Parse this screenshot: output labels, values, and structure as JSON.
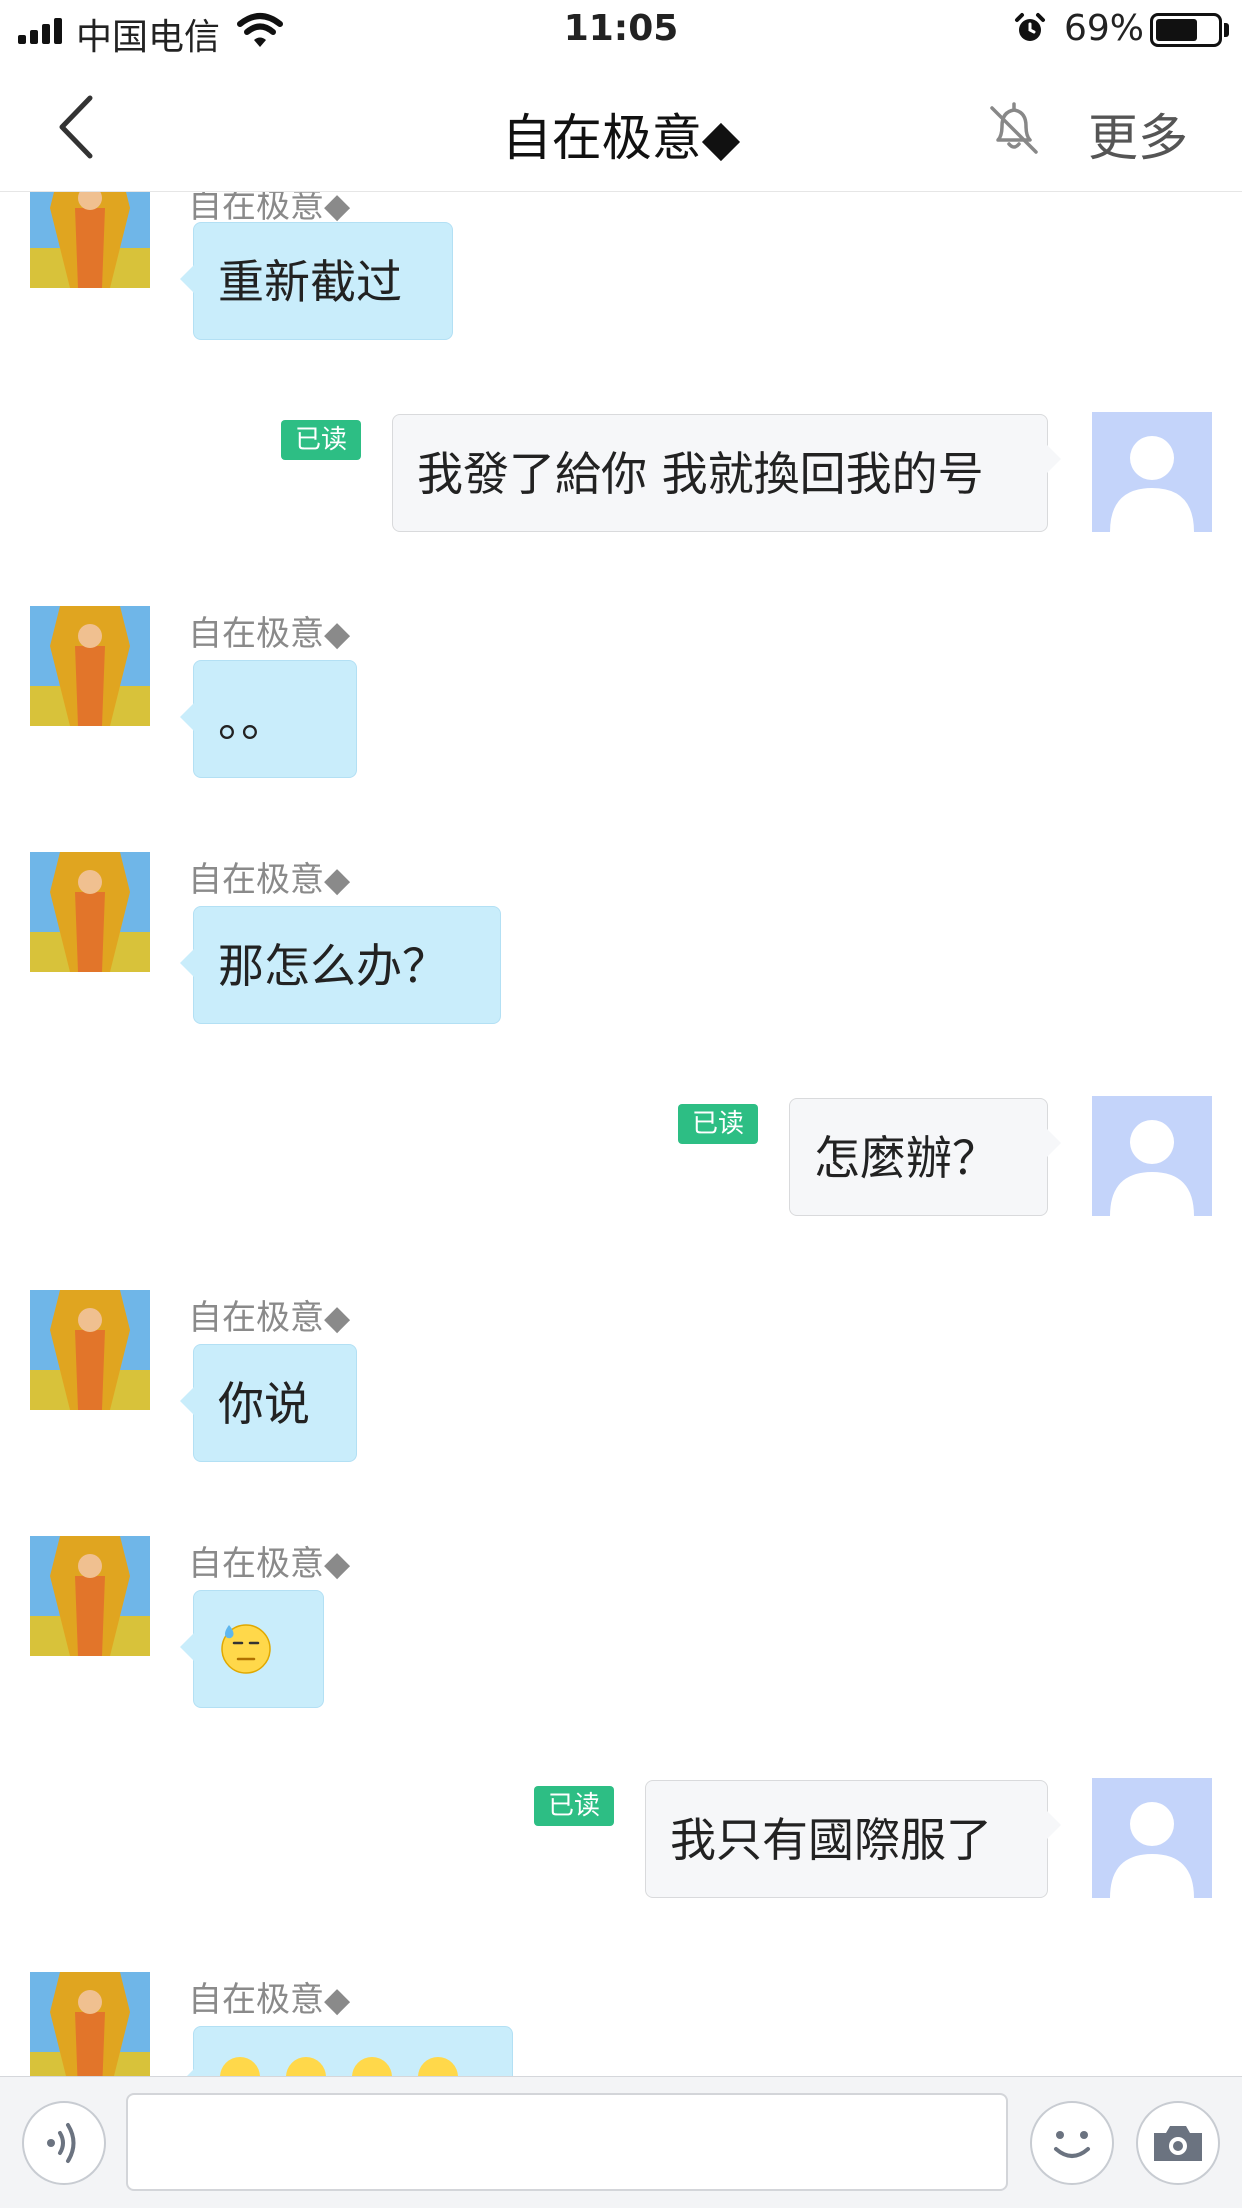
{
  "status_bar": {
    "carrier": "中国电信",
    "time": "11:05",
    "battery_percent": "69%",
    "battery_level": 0.69,
    "icons": [
      "signal-icon",
      "wifi-icon",
      "alarm-icon",
      "battery-icon"
    ]
  },
  "nav": {
    "title": "自在极意◆",
    "more_label": "更多",
    "icons": [
      "back-chevron-icon",
      "bell-muted-icon"
    ]
  },
  "messages": [
    {
      "direction": "in",
      "sender": "自在极意◆",
      "text": "重新截过"
    },
    {
      "direction": "out",
      "read": "已读",
      "text": "我發了給你 我就換回我的号"
    },
    {
      "direction": "in",
      "sender": "自在极意◆",
      "text": "。。"
    },
    {
      "direction": "in",
      "sender": "自在极意◆",
      "text": "那怎么办？"
    },
    {
      "direction": "out",
      "read": "已读",
      "text": "怎麼辦？"
    },
    {
      "direction": "in",
      "sender": "自在极意◆",
      "text": "你说"
    },
    {
      "direction": "in",
      "sender": "自在极意◆",
      "emoji": "sweat-smile-emoji"
    },
    {
      "direction": "out",
      "read": "已读",
      "text": "我只有國際服了"
    },
    {
      "direction": "in",
      "sender": "自在极意◆",
      "emoji": "crying-emoji-row"
    }
  ],
  "input_bar": {
    "value": "",
    "icons": [
      "voice-icon",
      "emoji-icon",
      "camera-icon"
    ]
  },
  "colors": {
    "incoming_bubble": "#c9edfb",
    "outgoing_bubble": "#f6f7f9",
    "read_badge": "#2dbe84",
    "my_avatar": "#c4d4fa"
  }
}
